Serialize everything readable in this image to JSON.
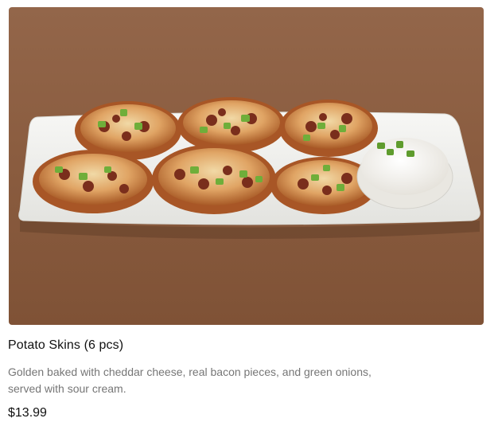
{
  "item": {
    "image_alt": "Potato Skins",
    "name": "Potato Skins (6 pcs)",
    "description": "Golden baked with cheddar cheese, real bacon pieces, and green onions, served with sour cream.",
    "price": "$13.99"
  },
  "colors": {
    "background_table": "#8a5c3d",
    "plate": "#f4f4f2",
    "skin": "#c87a3c",
    "bacon": "#7a2e1c",
    "onion": "#6fae3a",
    "sour_cream": "#f6f4ee"
  }
}
